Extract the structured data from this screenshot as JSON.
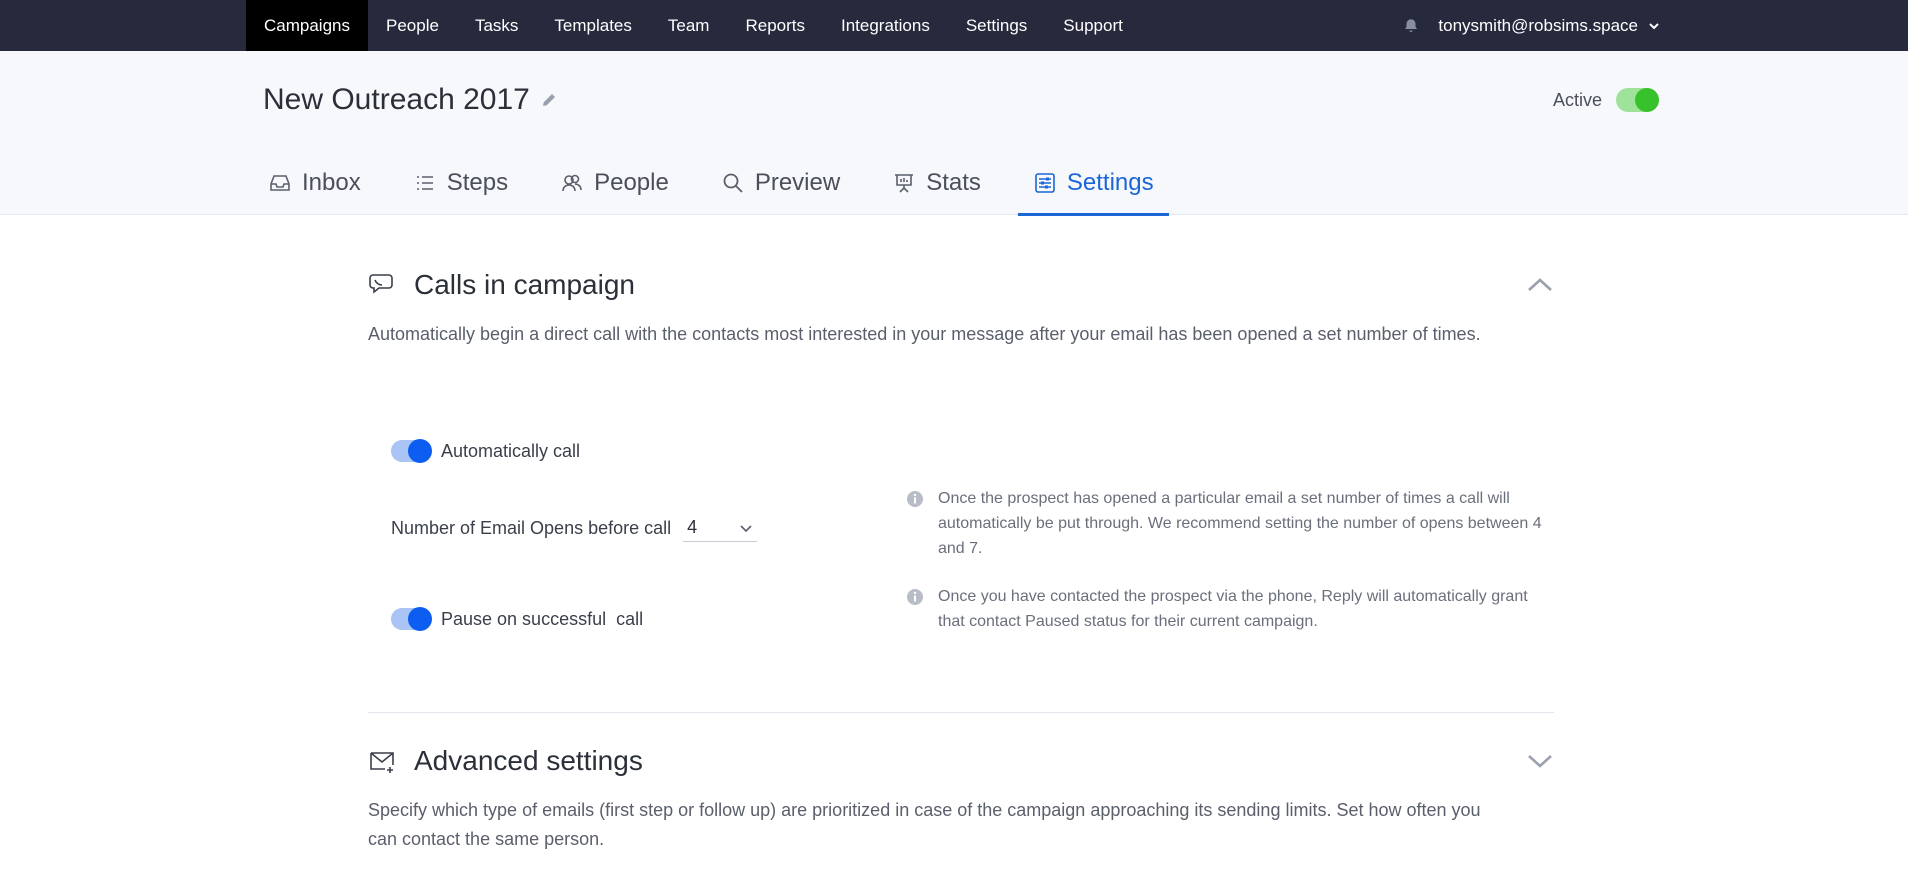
{
  "topnav": {
    "items": [
      {
        "label": "Campaigns",
        "active": true
      },
      {
        "label": "People",
        "active": false
      },
      {
        "label": "Tasks",
        "active": false
      },
      {
        "label": "Templates",
        "active": false
      },
      {
        "label": "Team",
        "active": false
      },
      {
        "label": "Reports",
        "active": false
      },
      {
        "label": "Integrations",
        "active": false
      },
      {
        "label": "Settings",
        "active": false
      },
      {
        "label": "Support",
        "active": false
      }
    ],
    "user_email": "tonysmith@robsims.space",
    "icons": {
      "notifications": "bell-icon",
      "user_menu": "chevron-down-icon"
    }
  },
  "header": {
    "title": "New Outreach 2017",
    "active_label": "Active",
    "active_on": true,
    "tabs": [
      {
        "label": "Inbox",
        "icon": "inbox-icon",
        "active": false
      },
      {
        "label": "Steps",
        "icon": "list-icon",
        "active": false
      },
      {
        "label": "People",
        "icon": "people-icon",
        "active": false
      },
      {
        "label": "Preview",
        "icon": "search-icon",
        "active": false
      },
      {
        "label": "Stats",
        "icon": "presentation-icon",
        "active": false
      },
      {
        "label": "Settings",
        "icon": "sliders-icon",
        "active": true
      }
    ]
  },
  "calls": {
    "title": "Calls in campaign",
    "description": "Automatically begin a direct call with the contacts most interested in your message after your email has been opened a set number of times.",
    "auto_call_label": "Automatically call",
    "auto_call_on": true,
    "opens_label": "Number of Email Opens before call",
    "opens_value": "4",
    "opens_hint": "Once the prospect has opened a particular email a set number of times a call will automatically be put through. We recommend setting the number of opens between 4 and 7.",
    "pause_label": "Pause on successful  call",
    "pause_on": true,
    "pause_hint": "Once you have contacted the prospect via the phone, Reply will automatically grant that contact Paused status for their current campaign."
  },
  "advanced": {
    "title": "Advanced settings",
    "description": "Specify which type of emails (first step or follow up) are prioritized in case of the campaign approaching its sending limits. Set how often you can contact the same person."
  },
  "colors": {
    "nav_bg": "#262a3c",
    "accent": "#1a66d6",
    "toggle_blue": "#0d5ef0",
    "toggle_green": "#37c22b"
  }
}
